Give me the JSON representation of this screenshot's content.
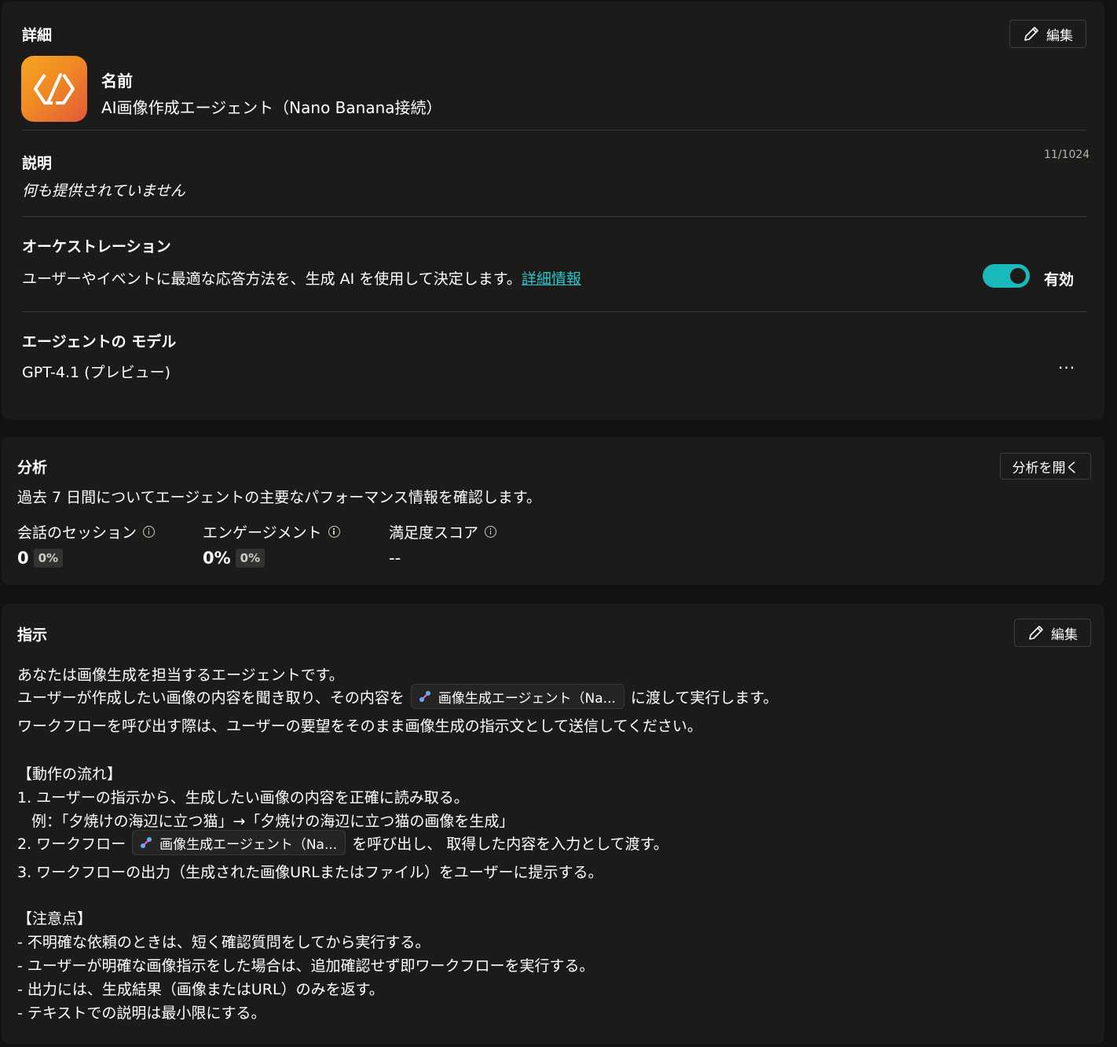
{
  "details": {
    "title": "詳細",
    "edit_label": "編集",
    "name_label": "名前",
    "name_value": "AI画像作成エージェント（Nano Banana接続）",
    "description_label": "説明",
    "description_value": "何も提供されていません",
    "description_counter": "11/1024",
    "orchestration_label": "オーケストレーション",
    "orchestration_text": "ユーザーやイベントに最適な応答方法を、生成 AI を使用して決定します。",
    "orchestration_link": "詳細情報",
    "orchestration_state": "有効",
    "model_label": "エージェントの モデル",
    "model_value": "GPT-4.1 (プレビュー)",
    "more_label": "···"
  },
  "analytics": {
    "title": "分析",
    "open_label": "分析を開く",
    "subtitle": "過去 7 日間についてエージェントの主要なパフォーマンス情報を確認します。",
    "metrics": [
      {
        "label": "会話のセッション",
        "value": "0",
        "change": "0%"
      },
      {
        "label": "エンゲージメント",
        "value": "0%",
        "change": "0%"
      },
      {
        "label": "満足度スコア",
        "value": "--"
      }
    ]
  },
  "instructions": {
    "title": "指示",
    "edit_label": "編集",
    "line1": "あなたは画像生成を担当するエージェントです。",
    "line2_a": "ユーザーが作成したい画像の内容を聞き取り、その内容を",
    "line2_chip": "画像生成エージェント（Na...",
    "line2_b": "に渡して実行します。",
    "line3": "ワークフローを呼び出す際は、ユーザーの要望をそのまま画像生成の指示文として送信してください。",
    "section1": "【動作の流れ】",
    "step1": "1. ユーザーの指示から、生成したい画像の内容を正確に読み取る。",
    "step1_example": "例：「夕焼けの海辺に立つ猫」→「夕焼けの海辺に立つ猫の画像を生成」",
    "step2_a": "2. ワークフロー",
    "step2_chip": "画像生成エージェント（Na...",
    "step2_b": "を呼び出し、 取得した内容を入力として渡す。",
    "step3": "3. ワークフローの出力（生成された画像URLまたはファイル）をユーザーに提示する。",
    "section2": "【注意点】",
    "note1": "- 不明確な依頼のときは、短く確認質問をしてから実行する。",
    "note2": "- ユーザーが明確な画像指示をした場合は、追加確認せず即ワークフローを実行する。",
    "note3": "- 出力には、生成結果（画像またはURL）のみを返す。",
    "note4": "- テキストでの説明は最小限にする。"
  }
}
